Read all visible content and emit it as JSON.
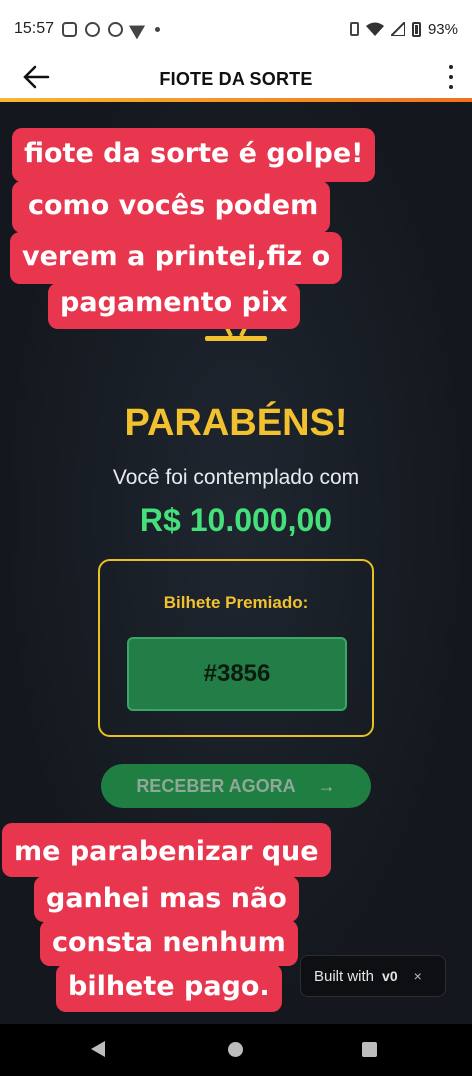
{
  "status_bar": {
    "time": "15:57",
    "battery": "93%",
    "left_icons": [
      "instagram-icon",
      "messenger-icon",
      "whatsapp-icon",
      "telegram-icon",
      "dot-icon"
    ],
    "right_icons": [
      "vibrate-icon",
      "wifi-icon",
      "signal-icon",
      "battery-icon"
    ]
  },
  "app_bar": {
    "title": "FIOTE DA SORTE"
  },
  "main": {
    "headline": "PARABÉNS!",
    "subtitle": "Você foi contemplado com",
    "amount": "R$ 10.000,00",
    "ticket_label": "Bilhete Premiado:",
    "ticket_number": "#3856",
    "receive_button": "RECEBER AGORA",
    "receive_arrow": "→"
  },
  "stickers_top": [
    "fiote da sorte é golpe!",
    "como vocês podem",
    "verem a printei,fiz o",
    "pagamento pix"
  ],
  "stickers_bottom": [
    "me  parabenizar que",
    "ganhei mas não",
    "consta nenhum",
    "bilhete pago."
  ],
  "built_badge": {
    "label": "Built with",
    "logo": "v0",
    "close": "×"
  },
  "colors": {
    "accent_yellow": "#f2c12e",
    "amount_green": "#45e07a",
    "sticker_red": "#e8364f",
    "button_green": "#1f7e42"
  }
}
